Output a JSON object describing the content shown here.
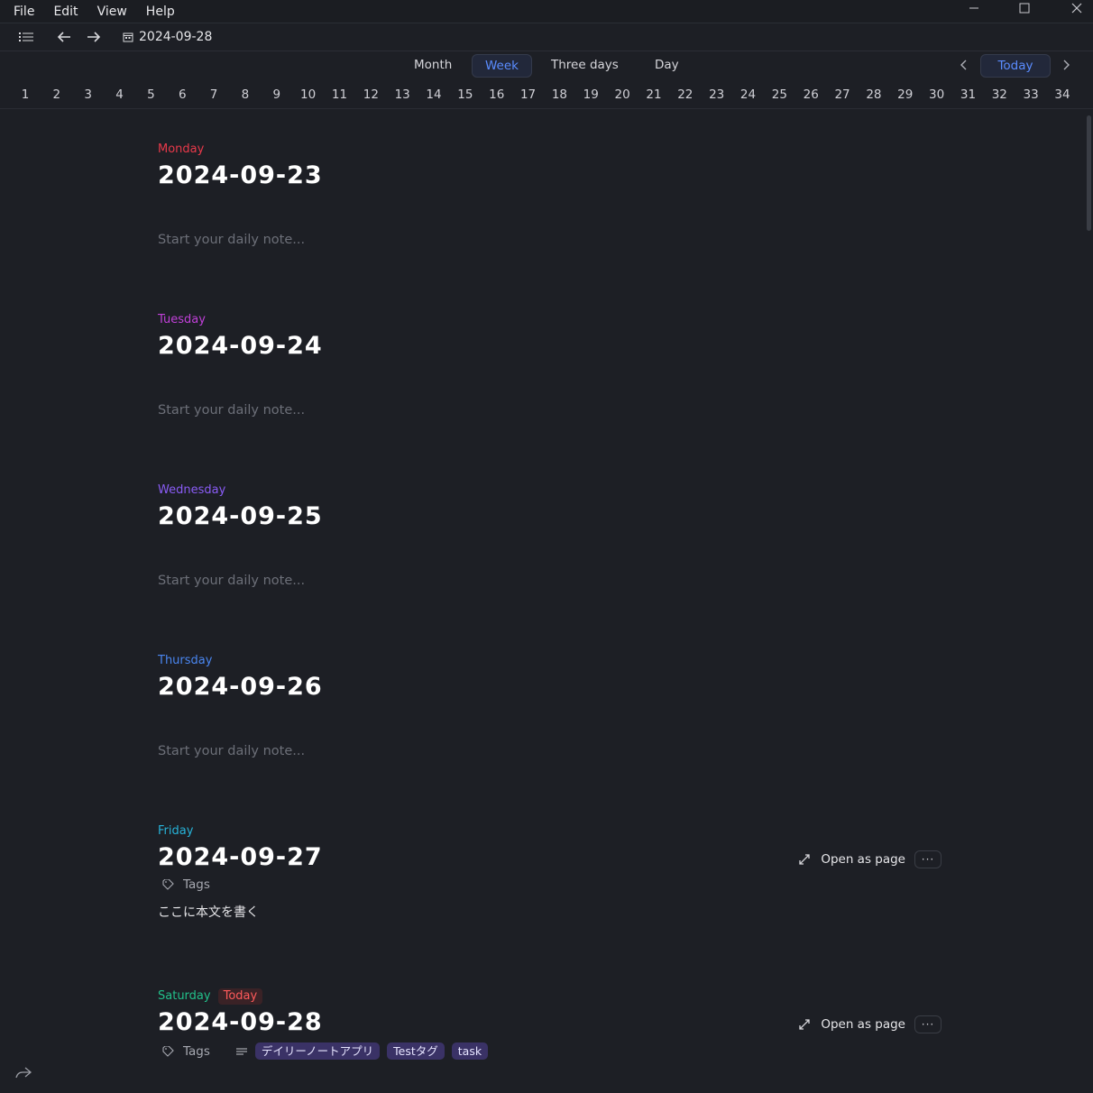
{
  "menu": [
    "File",
    "Edit",
    "View",
    "Help"
  ],
  "toolbar": {
    "date": "2024-09-28"
  },
  "views": {
    "month": "Month",
    "week": "Week",
    "three_days": "Three days",
    "day": "Day",
    "active": "Week"
  },
  "nav": {
    "today": "Today"
  },
  "week_numbers": [
    "1",
    "2",
    "3",
    "4",
    "5",
    "6",
    "7",
    "8",
    "9",
    "10",
    "11",
    "12",
    "13",
    "14",
    "15",
    "16",
    "17",
    "18",
    "19",
    "20",
    "21",
    "22",
    "23",
    "24",
    "25",
    "26",
    "27",
    "28",
    "29",
    "30",
    "31",
    "32",
    "33",
    "34"
  ],
  "placeholder": "Start your daily note...",
  "days": [
    {
      "weekday": "Monday",
      "date": "2024-09-23",
      "color": "#e8394a"
    },
    {
      "weekday": "Tuesday",
      "date": "2024-09-24",
      "color": "#c040d8"
    },
    {
      "weekday": "Wednesday",
      "date": "2024-09-25",
      "color": "#8a5cf6"
    },
    {
      "weekday": "Thursday",
      "date": "2024-09-26",
      "color": "#4a86f0"
    },
    {
      "weekday": "Friday",
      "date": "2024-09-27",
      "color": "#27b3d9",
      "open_as_page": "Open as page",
      "tags_label": "Tags",
      "body": "ここに本文を書く"
    },
    {
      "weekday": "Saturday",
      "date": "2024-09-28",
      "color": "#22c08a",
      "badge": "Today",
      "open_as_page": "Open as page",
      "tags_label": "Tags",
      "tags": [
        "デイリーノートアプリ",
        "Testタグ",
        "task"
      ]
    }
  ]
}
